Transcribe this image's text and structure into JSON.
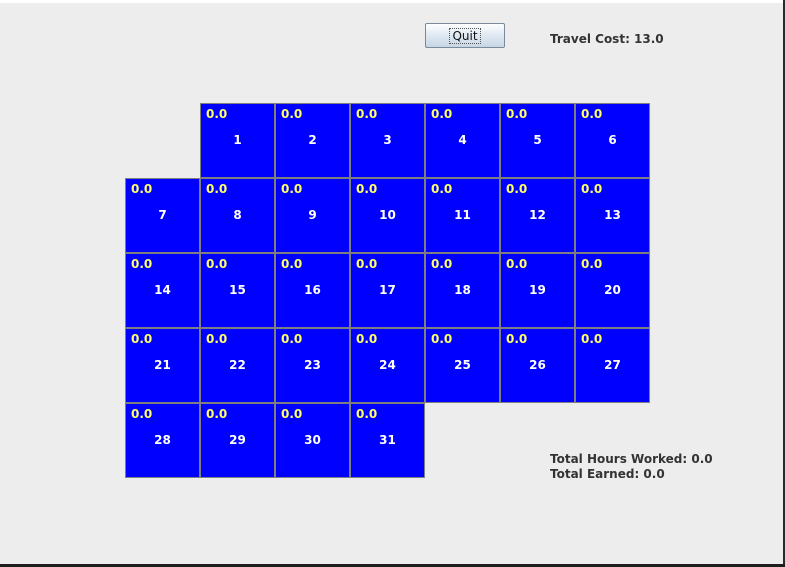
{
  "toolbar": {
    "quit_label": "Quit"
  },
  "travel_cost": "Travel Cost: 13.0",
  "totals": {
    "hours_worked": "Total Hours Worked: 0.0",
    "earned": "Total Earned: 0.0"
  },
  "colors": {
    "cell_bg": "#0000ff",
    "value_text": "#ffff66",
    "day_text": "#ffffff",
    "background": "#ededed"
  },
  "calendar": {
    "first_weekday_index": 1,
    "days": [
      {
        "day": "1",
        "value": "0.0"
      },
      {
        "day": "2",
        "value": "0.0"
      },
      {
        "day": "3",
        "value": "0.0"
      },
      {
        "day": "4",
        "value": "0.0"
      },
      {
        "day": "5",
        "value": "0.0"
      },
      {
        "day": "6",
        "value": "0.0"
      },
      {
        "day": "7",
        "value": "0.0"
      },
      {
        "day": "8",
        "value": "0.0"
      },
      {
        "day": "9",
        "value": "0.0"
      },
      {
        "day": "10",
        "value": "0.0"
      },
      {
        "day": "11",
        "value": "0.0"
      },
      {
        "day": "12",
        "value": "0.0"
      },
      {
        "day": "13",
        "value": "0.0"
      },
      {
        "day": "14",
        "value": "0.0"
      },
      {
        "day": "15",
        "value": "0.0"
      },
      {
        "day": "16",
        "value": "0.0"
      },
      {
        "day": "17",
        "value": "0.0"
      },
      {
        "day": "18",
        "value": "0.0"
      },
      {
        "day": "19",
        "value": "0.0"
      },
      {
        "day": "20",
        "value": "0.0"
      },
      {
        "day": "21",
        "value": "0.0"
      },
      {
        "day": "22",
        "value": "0.0"
      },
      {
        "day": "23",
        "value": "0.0"
      },
      {
        "day": "24",
        "value": "0.0"
      },
      {
        "day": "25",
        "value": "0.0"
      },
      {
        "day": "26",
        "value": "0.0"
      },
      {
        "day": "27",
        "value": "0.0"
      },
      {
        "day": "28",
        "value": "0.0"
      },
      {
        "day": "29",
        "value": "0.0"
      },
      {
        "day": "30",
        "value": "0.0"
      },
      {
        "day": "31",
        "value": "0.0"
      }
    ]
  }
}
